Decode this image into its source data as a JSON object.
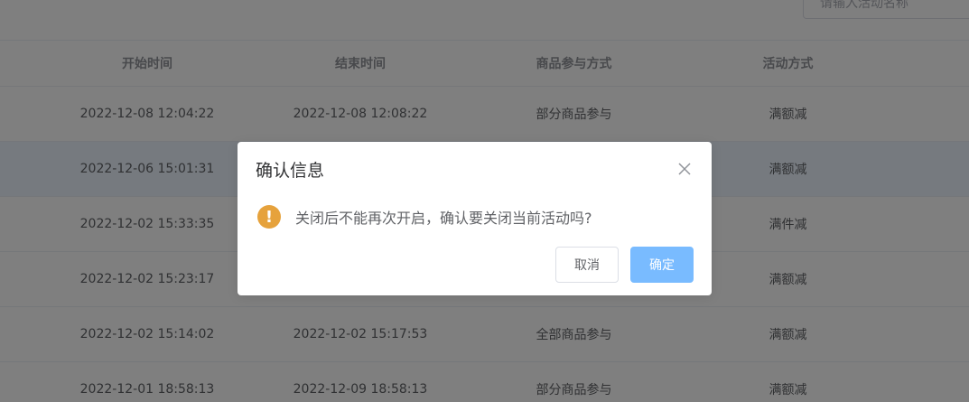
{
  "search": {
    "placeholder": "请输入活动名称"
  },
  "table": {
    "headers": [
      "",
      "开始时间",
      "结束时间",
      "商品参与方式",
      "活动方式",
      ""
    ],
    "rows": [
      {
        "start": "2022-12-08 12:04:22",
        "end": "2022-12-08 12:08:22",
        "scope": "部分商品参与",
        "mode": "满额减"
      },
      {
        "start": "2022-12-06 15:01:31",
        "end": "",
        "scope": "",
        "mode": "满额减"
      },
      {
        "start": "2022-12-02 15:33:35",
        "end": "",
        "scope": "",
        "mode": "满件减"
      },
      {
        "start": "2022-12-02 15:23:17",
        "end": "",
        "scope": "",
        "mode": "满额减"
      },
      {
        "start": "2022-12-02 15:14:02",
        "end": "2022-12-02 15:17:53",
        "scope": "全部商品参与",
        "mode": "满额减"
      },
      {
        "start": "2022-12-01 18:58:13",
        "end": "2022-12-09 18:58:13",
        "scope": "部分商品参与",
        "mode": "满额减"
      }
    ]
  },
  "dialog": {
    "title": "确认信息",
    "message": "关闭后不能再次开启，确认要关闭当前活动吗?",
    "cancel_label": "取消",
    "confirm_label": "确定",
    "warn_symbol": "!",
    "warn_color": "#e6a23c",
    "confirm_color": "#79bbff"
  }
}
